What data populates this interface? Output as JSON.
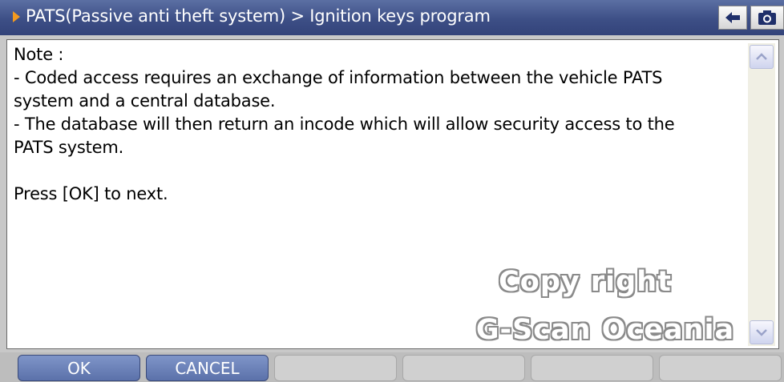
{
  "header": {
    "title": "PATS(Passive anti theft system) > Ignition keys program",
    "back_icon": "back-arrow-icon",
    "capture_icon": "camera-icon",
    "accent_color": "#f39a1e"
  },
  "content": {
    "lines": [
      "Note :",
      "- Coded access requires an exchange of information between the vehicle PATS",
      "system and a central database.",
      "- The database will then return an incode which will allow security access to the",
      "PATS system.",
      "",
      "Press [OK] to next."
    ]
  },
  "watermark": {
    "line1": "Copy right",
    "line2": "G-Scan Oceania"
  },
  "footer": {
    "ok_label": "OK",
    "cancel_label": "CANCEL"
  }
}
